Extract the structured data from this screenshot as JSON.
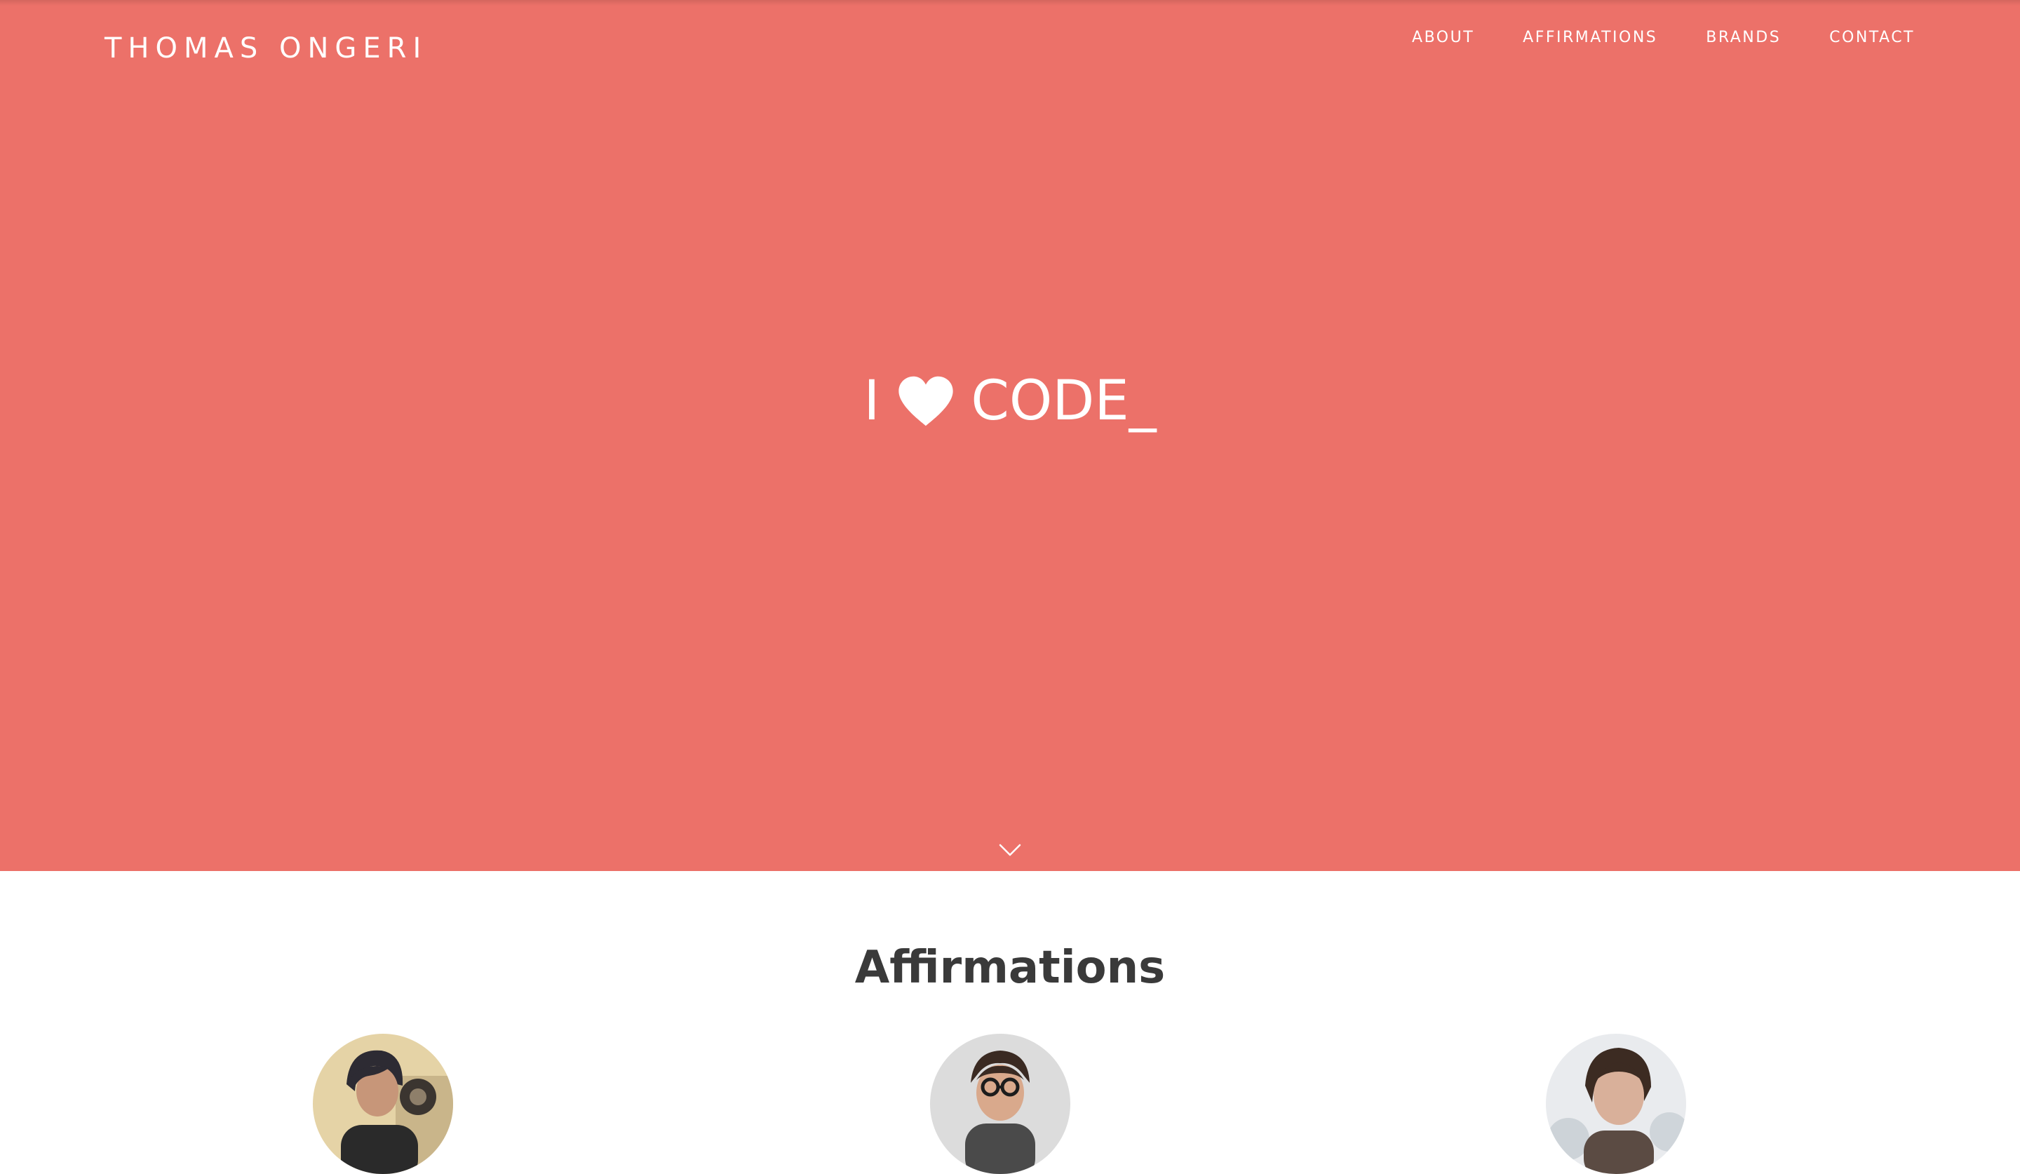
{
  "header": {
    "brand": "THOMAS ONGERI",
    "nav": [
      "ABOUT",
      "AFFIRMATIONS",
      "BRANDS",
      "CONTACT"
    ]
  },
  "hero": {
    "headline_start": "I",
    "headline_icon": "heart-icon",
    "headline_end": "CODE_",
    "background_color": "#ec7169",
    "scroll_icon": "chevron-down-icon"
  },
  "affirmations": {
    "title": "Affirmations"
  }
}
